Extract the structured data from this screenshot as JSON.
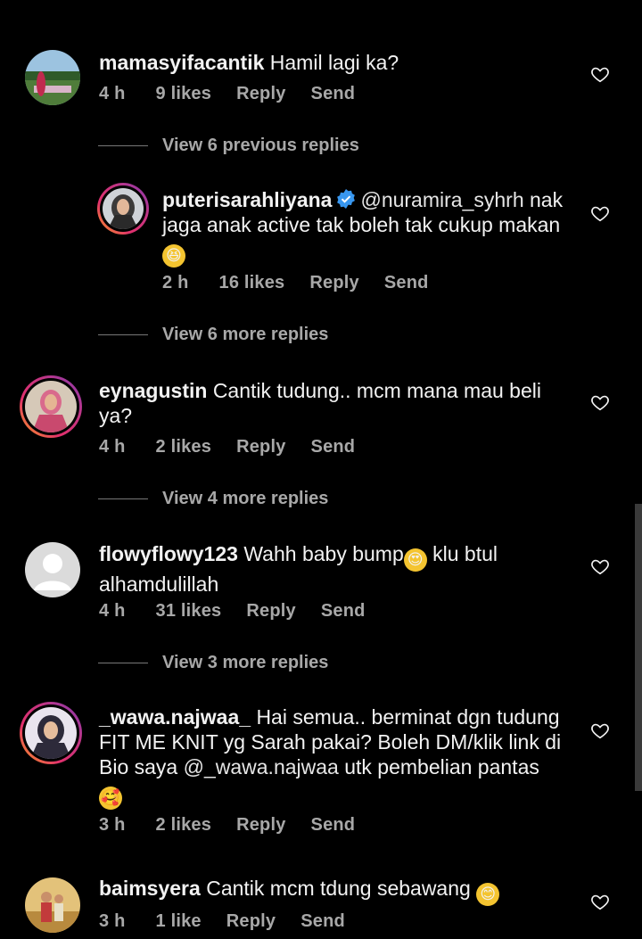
{
  "comments": [
    {
      "username": "mamasyifacantik",
      "text": "Hamil lagi ka?",
      "time": "4 h",
      "likes": "9 likes",
      "reply": "Reply",
      "send": "Send"
    },
    {
      "username": "puterisarahliyana",
      "mention": "@nuramira_syhrh",
      "text": "nak jaga anak active tak boleh tak cukup makan",
      "time": "2 h",
      "likes": "16 likes",
      "reply": "Reply",
      "send": "Send"
    },
    {
      "username": "eynagustin",
      "text": "Cantik tudung.. mcm mana mau beli ya?",
      "time": "4 h",
      "likes": "2 likes",
      "reply": "Reply",
      "send": "Send"
    },
    {
      "username": "flowyflowy123",
      "text": "Wahh baby bump",
      "text2": "klu btul alhamdulillah",
      "time": "4 h",
      "likes": "31 likes",
      "reply": "Reply",
      "send": "Send"
    },
    {
      "username": "_wawa.najwaa_",
      "text": "Hai semua.. berminat dgn tudung FIT ME KNIT yg Sarah pakai? Boleh DM/klik link di Bio saya",
      "mention": "@_wawa.najwaa",
      "text2": "utk pembelian pantas",
      "time": "3 h",
      "likes": "2 likes",
      "reply": "Reply",
      "send": "Send"
    },
    {
      "username": "baimsyera",
      "text": "Cantik mcm tdung sebawang",
      "time": "3 h",
      "likes": "1 like",
      "reply": "Reply",
      "send": "Send"
    }
  ],
  "view_replies": [
    "View 6 previous replies",
    "View 6 more replies",
    "View 4 more replies",
    "View 3 more replies"
  ],
  "icons": {
    "like": "heart-outline-icon",
    "verified": "verified-badge-icon"
  },
  "colors": {
    "background": "#000000",
    "text": "#f2f2f2",
    "secondary": "#a8a8a8",
    "verified": "#3897f0"
  }
}
